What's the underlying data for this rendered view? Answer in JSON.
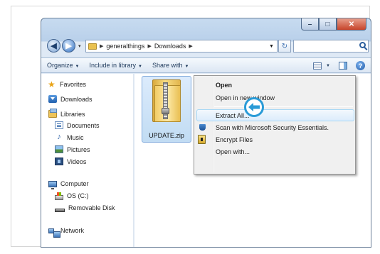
{
  "address": {
    "crumbs": [
      "generalthings",
      "Downloads"
    ]
  },
  "toolbar": {
    "organize": "Organize",
    "include_in_library": "Include in library",
    "share_with": "Share with"
  },
  "sidebar": {
    "favorites": "Favorites",
    "downloads": "Downloads",
    "libraries": "Libraries",
    "documents": "Documents",
    "music": "Music",
    "pictures": "Pictures",
    "videos": "Videos",
    "computer": "Computer",
    "os_drive": "OS (C:)",
    "removable_disk": "Removable Disk",
    "network": "Network"
  },
  "files": [
    {
      "name": "UPDATE.zip",
      "icon": "zip-folder-icon",
      "selected": true
    }
  ],
  "context_menu": {
    "items": [
      {
        "label": "Open",
        "bold": true
      },
      {
        "label": "Open in new window"
      },
      {
        "label": "Extract All...",
        "highlighted": true
      },
      {
        "label": "Scan with Microsoft Security Essentials.",
        "icon": "shield-icon"
      },
      {
        "label": "Encrypt Files",
        "icon": "lock-icon"
      },
      {
        "label": "Open with..."
      }
    ]
  },
  "colors": {
    "callout_accent": "#2a9bd7",
    "selection_bg": "#c1dcf3"
  }
}
